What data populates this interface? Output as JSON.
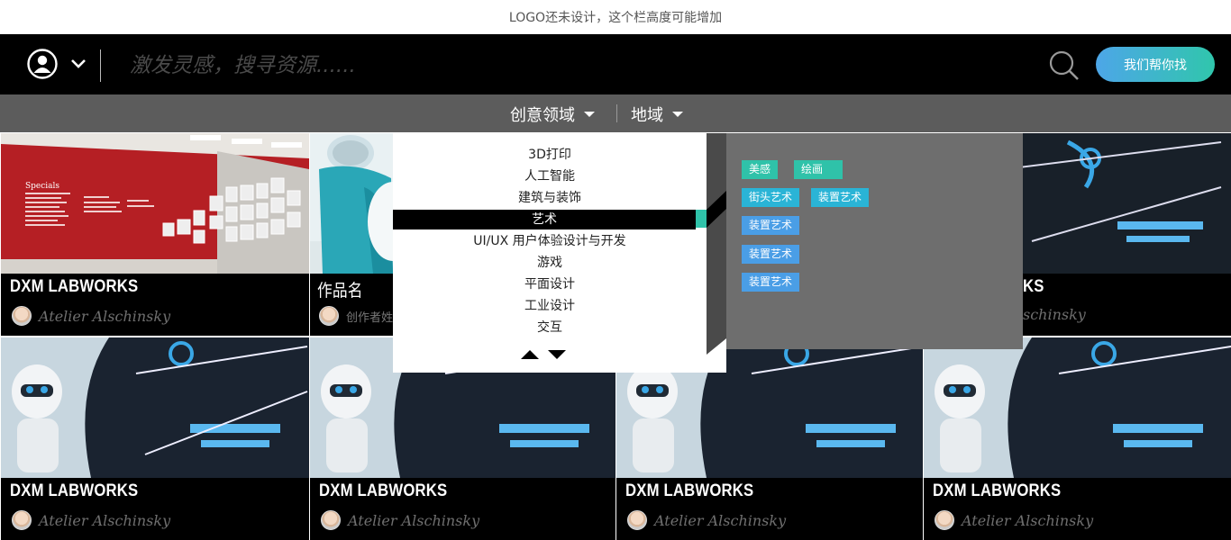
{
  "logo_text": "LOGO还未设计，这个栏高度可能增加",
  "search": {
    "placeholder": "激发灵感，搜寻资源......"
  },
  "help_button": "我们帮你找",
  "filters": {
    "creative": "创意领域",
    "region": "地域"
  },
  "dropdown": {
    "items": [
      "3D打印",
      "人工智能",
      "建筑与装饰",
      "艺术",
      "UI/UX 用户体验设计与开发",
      "游戏",
      "平面设计",
      "工业设计",
      "交互"
    ],
    "active_index": 3
  },
  "subtags": [
    "美感",
    "绘画",
    "街头艺术",
    "装置艺术",
    "装置艺术",
    "装置艺术",
    "装置艺术"
  ],
  "cards": [
    {
      "title": "DXM LABWORKS",
      "author": "Atelier Alschinsky",
      "image": "gallery-wall"
    },
    {
      "title": "作品名",
      "author": "创作者姓",
      "image": "lamp-product"
    },
    {
      "title": "DXM LABWORKS",
      "author": "Atelier Alschinsky",
      "image": "robot"
    },
    {
      "title": "DXM LABWORKS",
      "author": "Atelier Alschinsky",
      "image": "robot"
    },
    {
      "title": "DXM LABWORKS",
      "author": "Atelier Alschinsky",
      "image": "robot"
    },
    {
      "title": "DXM LABWORKS",
      "author": "Atelier Alschinsky",
      "image": "robot"
    },
    {
      "title": "DXM LABWORKS",
      "author": "Atelier Alschinsky",
      "image": "robot"
    }
  ],
  "partial_texts": {
    "card4_title_fragment": "KS",
    "card4_author_fragment": "schinsky"
  },
  "colors": {
    "accent_green": "#2fc2a9",
    "accent_blue": "#4da6e8",
    "tag_teal": "#2ab4d6",
    "tag_blue": "#4a9ee6"
  },
  "gallery_specials_heading": "Specials"
}
